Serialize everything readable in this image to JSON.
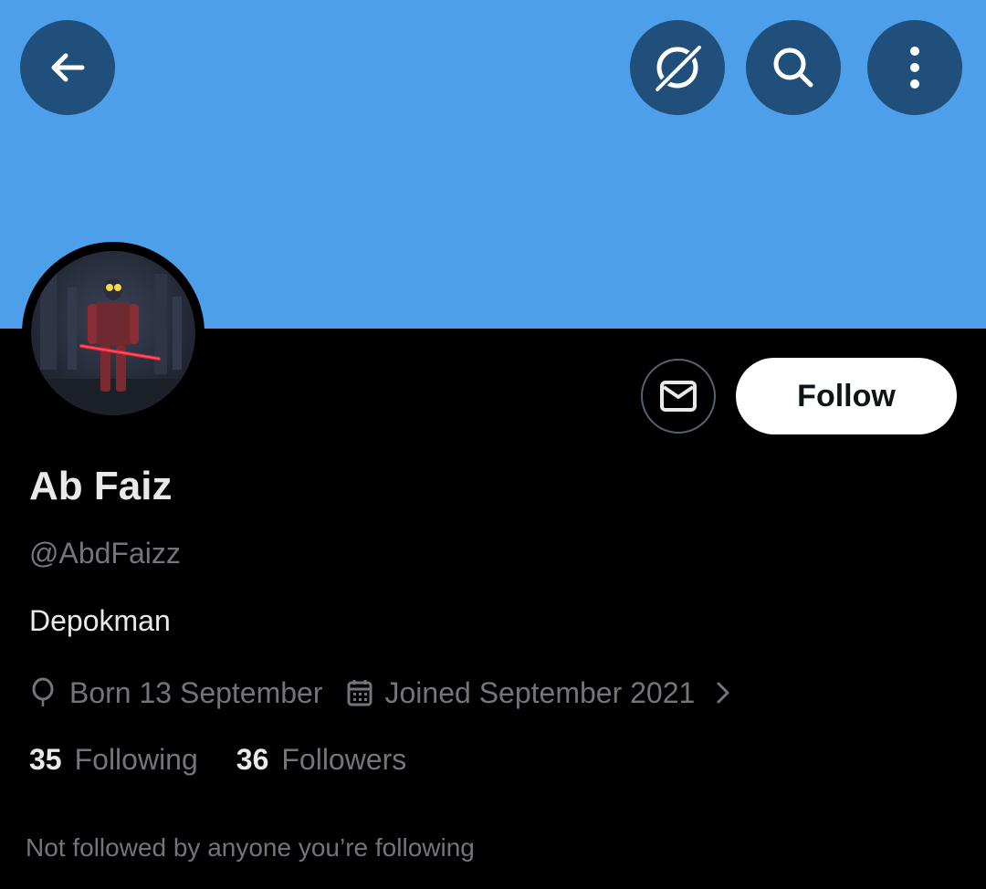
{
  "header": {
    "back_icon": "arrow-left-icon",
    "grok_icon": "grok-icon",
    "search_icon": "search-icon",
    "more_icon": "more-vertical-icon",
    "banner_color": "#4d9fe9",
    "button_color": "#1f4f7a"
  },
  "profile": {
    "name": "Ab Faiz",
    "handle": "@AbdFaizz",
    "bio": "Depokman",
    "born": "Born 13 September",
    "joined": "Joined September 2021",
    "born_icon": "balloon-icon",
    "joined_icon": "calendar-icon"
  },
  "actions": {
    "message_icon": "envelope-icon",
    "follow_label": "Follow"
  },
  "stats": {
    "following_count": "35",
    "following_label": "Following",
    "followers_count": "36",
    "followers_label": "Followers"
  },
  "footer": {
    "not_followed_text": "Not followed by anyone you’re following"
  }
}
